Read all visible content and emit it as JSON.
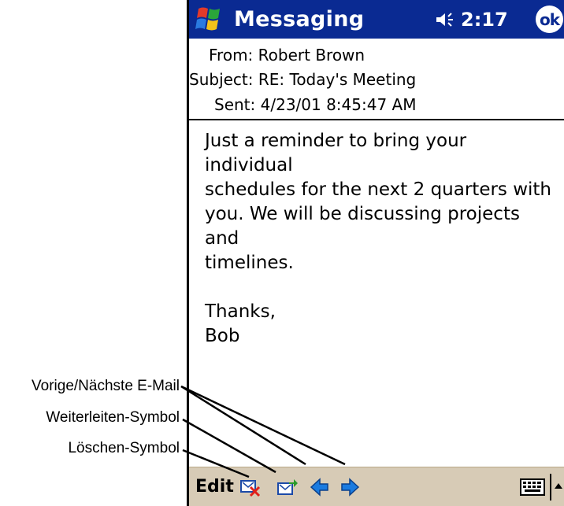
{
  "titlebar": {
    "app_title": "Messaging",
    "clock": "2:17",
    "ok_label": "ok"
  },
  "message": {
    "from_label": "From:",
    "from_value": "Robert Brown",
    "subject_label": "Subject:",
    "subject_value": "RE: Today's Meeting",
    "sent_label": "Sent:",
    "sent_value": "4/23/01 8:45:47 AM",
    "body": "Just a reminder to bring your individual\nschedules for the next 2 quarters with\nyou. We will be discussing projects and\ntimelines.\n\nThanks,\nBob"
  },
  "toolbar": {
    "edit_label": "Edit",
    "icons": [
      "delete-icon",
      "forward-icon",
      "previous-icon",
      "next-icon",
      "keyboard-icon",
      "arrow-up-icon"
    ]
  },
  "callouts": {
    "prev_next": "Vorige/Nächste E-Mail",
    "forward": "Weiterleiten-Symbol",
    "delete": "Löschen-Symbol"
  },
  "colors": {
    "titlebar": "#0a2a92",
    "toolbar": "#d7cbb6",
    "arrow": "#1a7be0"
  }
}
